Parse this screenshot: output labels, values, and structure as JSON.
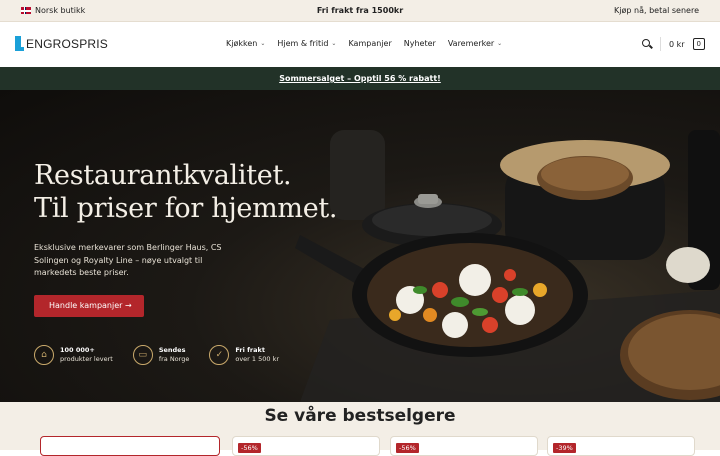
{
  "topbar": {
    "store_label": "Norsk butikk",
    "shipping_label": "Fri frakt fra 1500kr",
    "payment_label": "Kjøp nå, betal senere"
  },
  "header": {
    "logo_text": "ENGROSPRIS",
    "nav": [
      {
        "label": "Kjøkken",
        "has_dropdown": true
      },
      {
        "label": "Hjem & fritid",
        "has_dropdown": true
      },
      {
        "label": "Kampanjer",
        "has_dropdown": false
      },
      {
        "label": "Nyheter",
        "has_dropdown": false
      },
      {
        "label": "Varemerker",
        "has_dropdown": true
      }
    ],
    "cart_total": "0 kr",
    "cart_count": "0"
  },
  "promo": {
    "text": "Sommersalget – Opptil 56 % rabatt!"
  },
  "hero": {
    "title_line1": "Restaurantkvalitet.",
    "title_line2": "Til priser for hjemmet.",
    "subtitle": "Eksklusive merkevarer som Berlinger Haus, CS Solingen og Royalty Line – nøye utvalgt til markedets beste priser.",
    "cta_label": "Handle kampanjer →",
    "usps": [
      {
        "icon": "gift-icon",
        "title": "100 000+",
        "text": "produkter levert"
      },
      {
        "icon": "truck-icon",
        "title": "Sendes",
        "text": "fra Norge"
      },
      {
        "icon": "shield-icon",
        "title": "Fri frakt",
        "text": "over 1 500 kr"
      }
    ]
  },
  "bestsellers": {
    "title": "Se våre bestselgere",
    "badges": [
      "-56%",
      "-56%",
      "-39%"
    ]
  },
  "colors": {
    "accent": "#b3262b",
    "promo_bg": "#223228",
    "brand_blue": "#1aa0d8",
    "cream": "#f3eee6"
  }
}
